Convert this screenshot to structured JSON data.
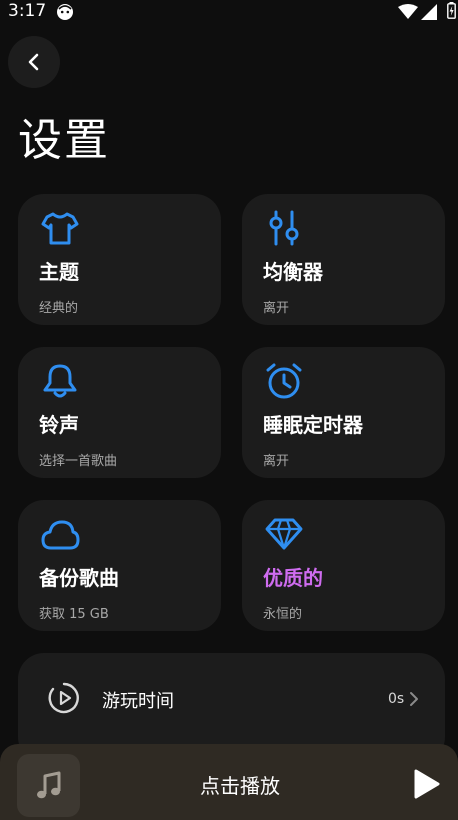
{
  "status_bar": {
    "time": "3:17"
  },
  "page": {
    "title": "设置"
  },
  "cards": [
    {
      "icon": "shirt-icon",
      "title": "主题",
      "subtitle": "经典的"
    },
    {
      "icon": "equalizer-sliders-icon",
      "title": "均衡器",
      "subtitle": "离开"
    },
    {
      "icon": "bell-icon",
      "title": "铃声",
      "subtitle": "选择一首歌曲"
    },
    {
      "icon": "alarm-clock-icon",
      "title": "睡眠定时器",
      "subtitle": "离开"
    },
    {
      "icon": "cloud-icon",
      "title": "备份歌曲",
      "subtitle": "获取 15 GB"
    },
    {
      "icon": "diamond-icon",
      "title": "优质的",
      "subtitle": "永恒的"
    }
  ],
  "play_time": {
    "label": "游玩时间",
    "value": "0s"
  },
  "mini_player": {
    "label": "点击播放"
  },
  "colors": {
    "accent": "#2f8ef0",
    "premium": "#cf6cf0",
    "card_bg": "#1c1c1c",
    "player_bg": "#2f2a23"
  }
}
